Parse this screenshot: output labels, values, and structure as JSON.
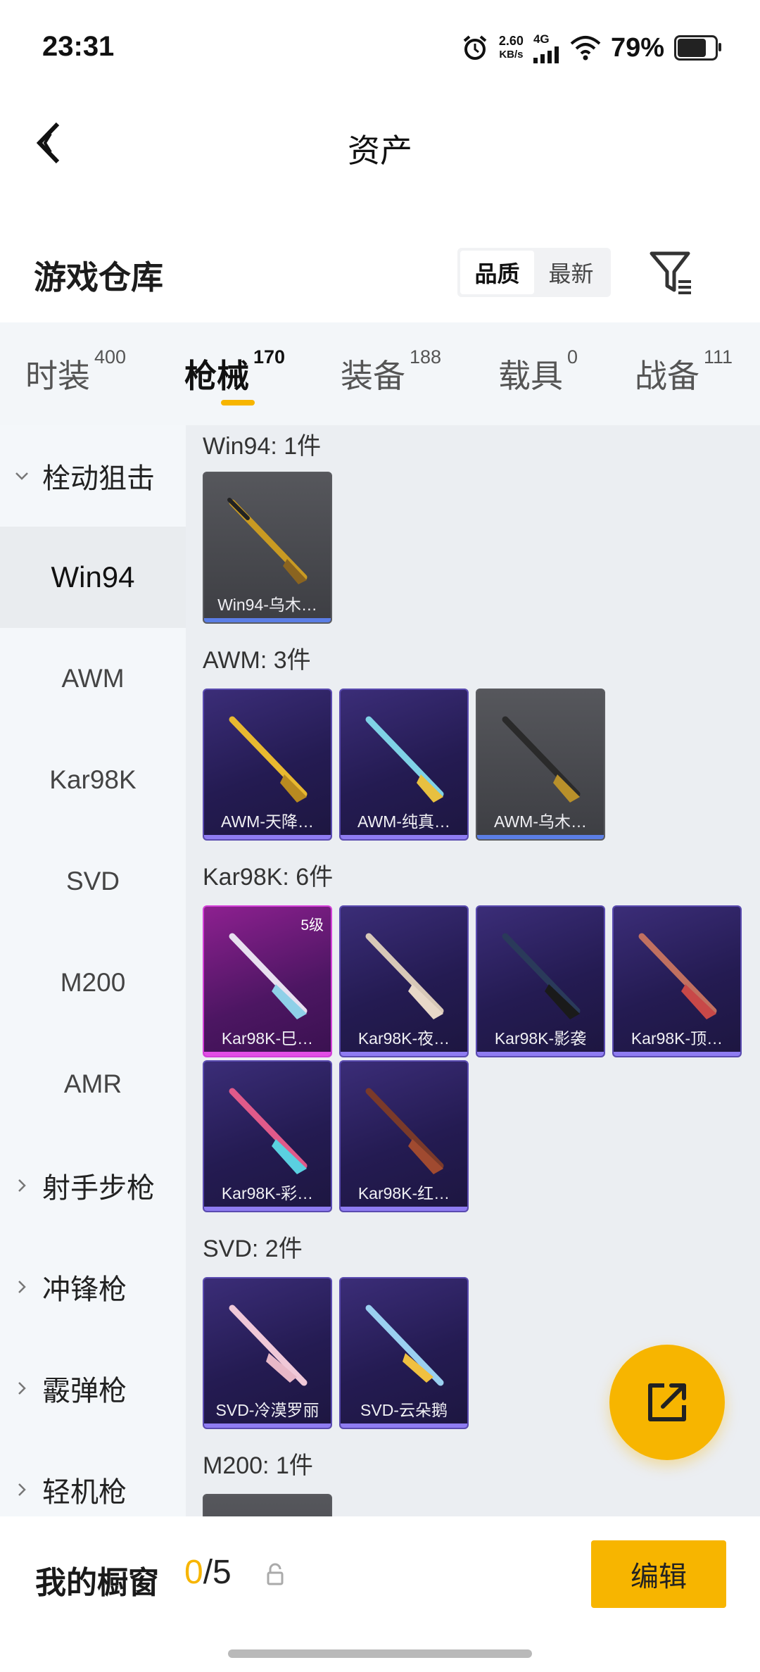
{
  "status_bar": {
    "time": "23:31",
    "speed_value": "2.60",
    "speed_unit": "KB/s",
    "network": "4G",
    "battery_pct": "79%",
    "battery_level": 0.79,
    "icons": [
      "alarm-icon",
      "signal-icon",
      "wifi-icon",
      "battery-icon"
    ]
  },
  "header": {
    "title": "资产",
    "back_icon": "chevron-left-icon"
  },
  "warehouse": {
    "title": "游戏仓库",
    "sort_options": [
      "品质",
      "最新"
    ],
    "sort_selected": "品质",
    "filter_icon": "filter-icon"
  },
  "tabs": [
    {
      "label": "时装",
      "count": "400"
    },
    {
      "label": "枪械",
      "count": "170",
      "active": true
    },
    {
      "label": "装备",
      "count": "188"
    },
    {
      "label": "载具",
      "count": "0"
    },
    {
      "label": "战备",
      "count": "111"
    }
  ],
  "sidebar": {
    "items": [
      {
        "label": "栓动狙击",
        "type": "category",
        "expanded": true
      },
      {
        "label": "Win94",
        "type": "sub",
        "active": true
      },
      {
        "label": "AWM",
        "type": "sub"
      },
      {
        "label": "Kar98K",
        "type": "sub"
      },
      {
        "label": "SVD",
        "type": "sub"
      },
      {
        "label": "M200",
        "type": "sub"
      },
      {
        "label": "AMR",
        "type": "sub"
      },
      {
        "label": "射手步枪",
        "type": "category"
      },
      {
        "label": "冲锋枪",
        "type": "category"
      },
      {
        "label": "霰弹枪",
        "type": "category"
      },
      {
        "label": "轻机枪",
        "type": "category"
      }
    ]
  },
  "groups": [
    {
      "title": "Win94: 1件",
      "items": [
        {
          "label": "Win94-乌木…",
          "rarity": "gray"
        }
      ]
    },
    {
      "title": "AWM: 3件",
      "items": [
        {
          "label": "AWM-天降…",
          "rarity": "purple"
        },
        {
          "label": "AWM-纯真…",
          "rarity": "purple"
        },
        {
          "label": "AWM-乌木…",
          "rarity": "gray"
        }
      ]
    },
    {
      "title": "Kar98K: 6件",
      "items": [
        {
          "label": "Kar98K-巳…",
          "rarity": "pink",
          "grade": "5级"
        },
        {
          "label": "Kar98K-夜…",
          "rarity": "purple"
        },
        {
          "label": "Kar98K-影袭",
          "rarity": "purple"
        },
        {
          "label": "Kar98K-顶…",
          "rarity": "purple"
        },
        {
          "label": "Kar98K-彩…",
          "rarity": "purple"
        },
        {
          "label": "Kar98K-红…",
          "rarity": "purple"
        }
      ]
    },
    {
      "title": "SVD: 2件",
      "items": [
        {
          "label": "SVD-冷漠罗丽",
          "rarity": "purple"
        },
        {
          "label": "SVD-云朵鹅",
          "rarity": "purple"
        }
      ]
    },
    {
      "title": "M200: 1件",
      "items": [
        {
          "label": "",
          "rarity": "gray"
        }
      ]
    }
  ],
  "fab": {
    "icon": "share-icon"
  },
  "showcase": {
    "label": "我的橱窗",
    "current": "0",
    "separator_total": "/5",
    "lock_icon": "lock-icon",
    "edit_label": "编辑"
  },
  "colors": {
    "accent": "#f7b500",
    "tab_bg": "#f3f6f9",
    "content_bg": "#ebeef2",
    "rarity_purple": "#3b2d78",
    "rarity_gray": "#56575c",
    "rarity_pink": "#8d2090"
  }
}
